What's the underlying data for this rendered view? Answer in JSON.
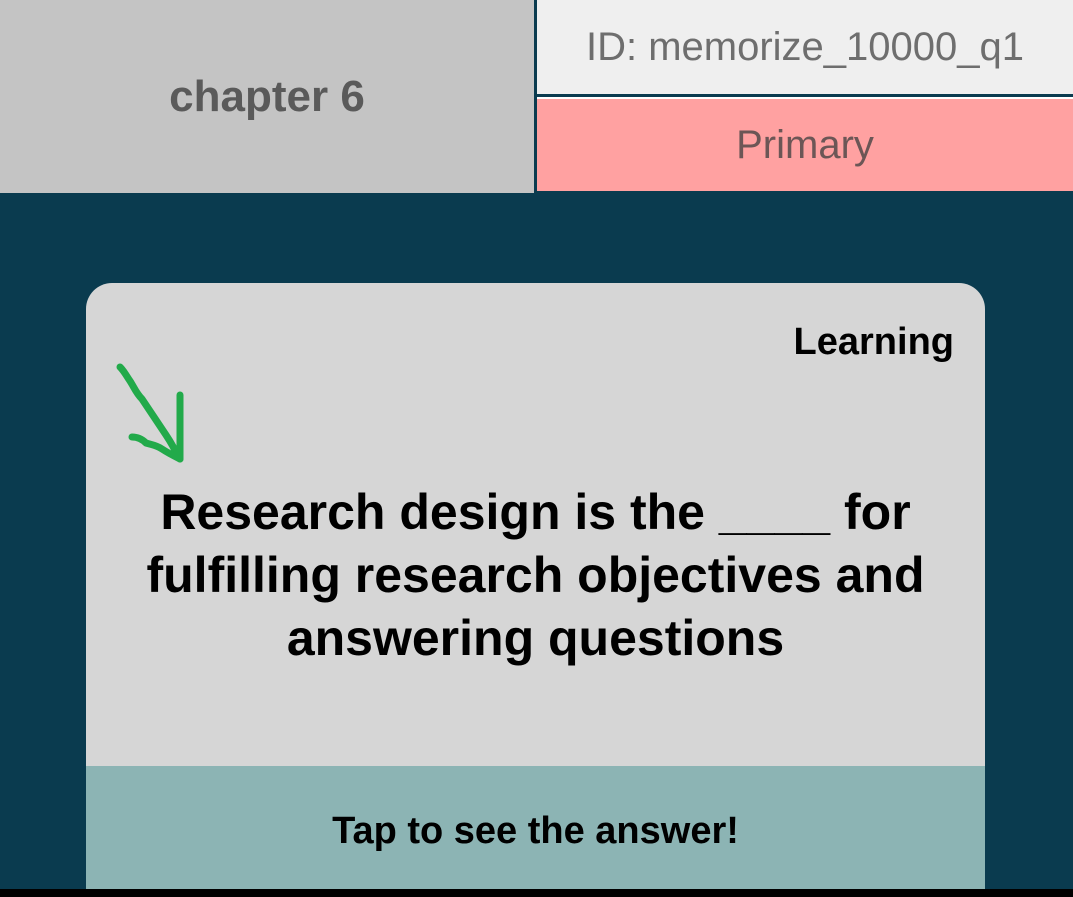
{
  "header": {
    "chapter_label": "chapter 6",
    "question_id": "ID: memorize_10000_q1",
    "deck_label": "Primary"
  },
  "card": {
    "status": "Learning",
    "arrow_icon": "hand-drawn-arrow-icon",
    "question": "Research design is the ____ for fulfilling research objectives and answering questions",
    "reveal_label": "Tap to see the answer!"
  },
  "colors": {
    "background": "#0a3b4f",
    "chapter_tile": "#c4c4c4",
    "id_tile": "#efefef",
    "deck_tile": "#ffa1a1",
    "card": "#d6d6d6",
    "reveal_bar": "#8cb4b4",
    "annotation_green": "#22aa4a"
  }
}
